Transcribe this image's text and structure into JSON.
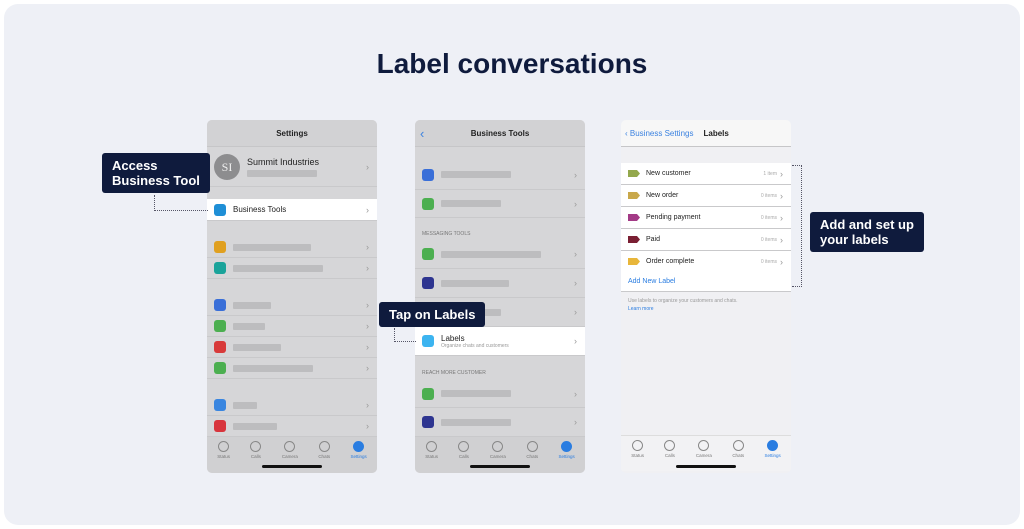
{
  "title": "Label conversations",
  "callouts": [
    "Access\nBusiness Tool",
    "Tap on Labels",
    "Add and set up\nyour labels"
  ],
  "phone1": {
    "header": "Settings",
    "profile_name": "Summit Industries",
    "avatar": "SI",
    "business_tools": "Business Tools",
    "icon_colors": [
      "#e0a020",
      "#1aa39a",
      "#3a6fd8",
      "#4caf50",
      "#d83a3a",
      "#4caf50",
      "#3a86e0",
      "#d8343c"
    ]
  },
  "phone2": {
    "header": "Business Tools",
    "section1": "MESSAGING TOOLS",
    "section2": "REACH MORE CUSTOMER",
    "labels_title": "Labels",
    "labels_sub": "Organize chats and customers",
    "icon_colors": [
      "#3a6fd8",
      "#4caf50",
      "#4caf50",
      "#2e3590",
      "#4caf50",
      "#4caf50",
      "#2e3590"
    ]
  },
  "phone3": {
    "back": "Business Settings",
    "header": "Labels",
    "labels": [
      {
        "name": "New customer",
        "count": "1 item",
        "color": "#93a84c"
      },
      {
        "name": "New order",
        "count": "0 items",
        "color": "#c9a84a"
      },
      {
        "name": "Pending payment",
        "count": "0 items",
        "color": "#a33a86"
      },
      {
        "name": "Paid",
        "count": "0 items",
        "color": "#7a1f33"
      },
      {
        "name": "Order complete",
        "count": "0 items",
        "color": "#e8b63a"
      }
    ],
    "add_label": "Add New Label",
    "footer": "Use labels to organize your customers and chats.",
    "learn_more": "Learn more"
  },
  "tabs": [
    "Status",
    "Calls",
    "Camera",
    "Chats",
    "Settings"
  ],
  "accent": "#2a7de1"
}
